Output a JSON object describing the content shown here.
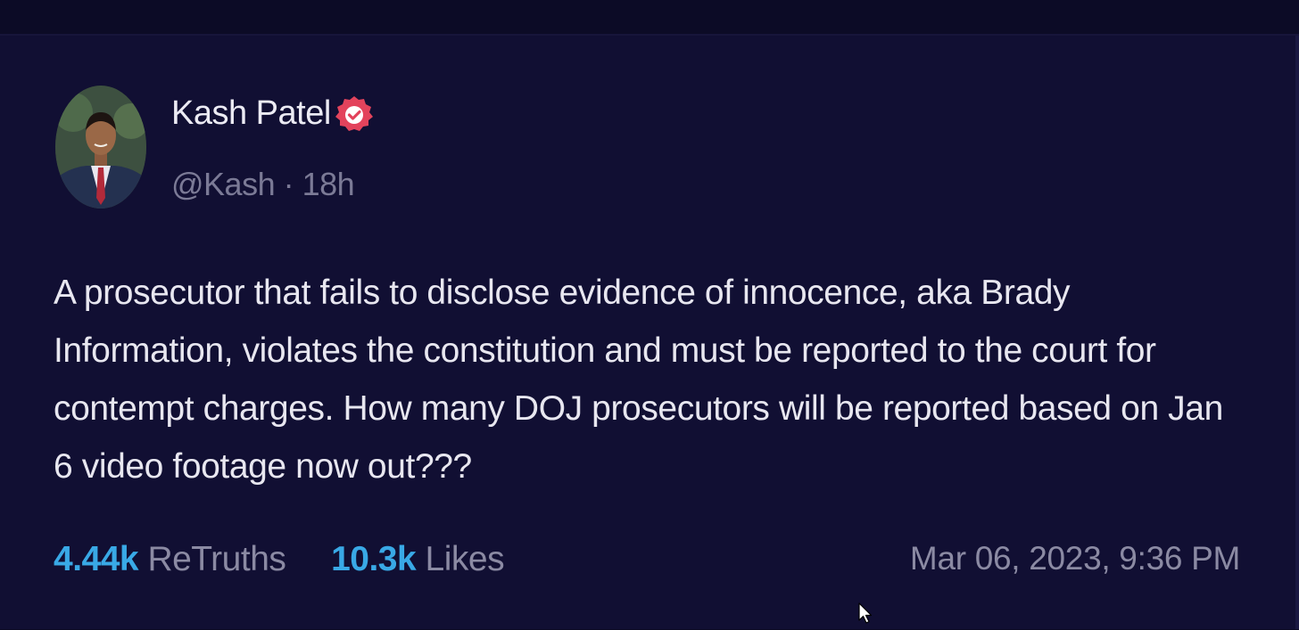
{
  "post": {
    "author": {
      "display_name": "Kash Patel",
      "handle_and_time": "@Kash · 18h",
      "verified": true,
      "badge_color": "#e3435c"
    },
    "body": "A prosecutor that fails to disclose evidence of innocence, aka Brady Information, violates the constitution and must be reported to the court for contempt charges. How many DOJ prosecutors will be reported based on Jan 6 video footage now out???",
    "stats": {
      "retruths_count": "4.44k",
      "retruths_label": "ReTruths",
      "likes_count": "10.3k",
      "likes_label": "Likes"
    },
    "timestamp": "Mar 06, 2023, 9:36 PM"
  },
  "colors": {
    "background": "#110f33",
    "accent": "#39a9e6",
    "muted_text": "#8b8aa3"
  },
  "icons": {
    "badge": "verified-badge-icon",
    "cursor": "mouse-pointer-icon"
  }
}
